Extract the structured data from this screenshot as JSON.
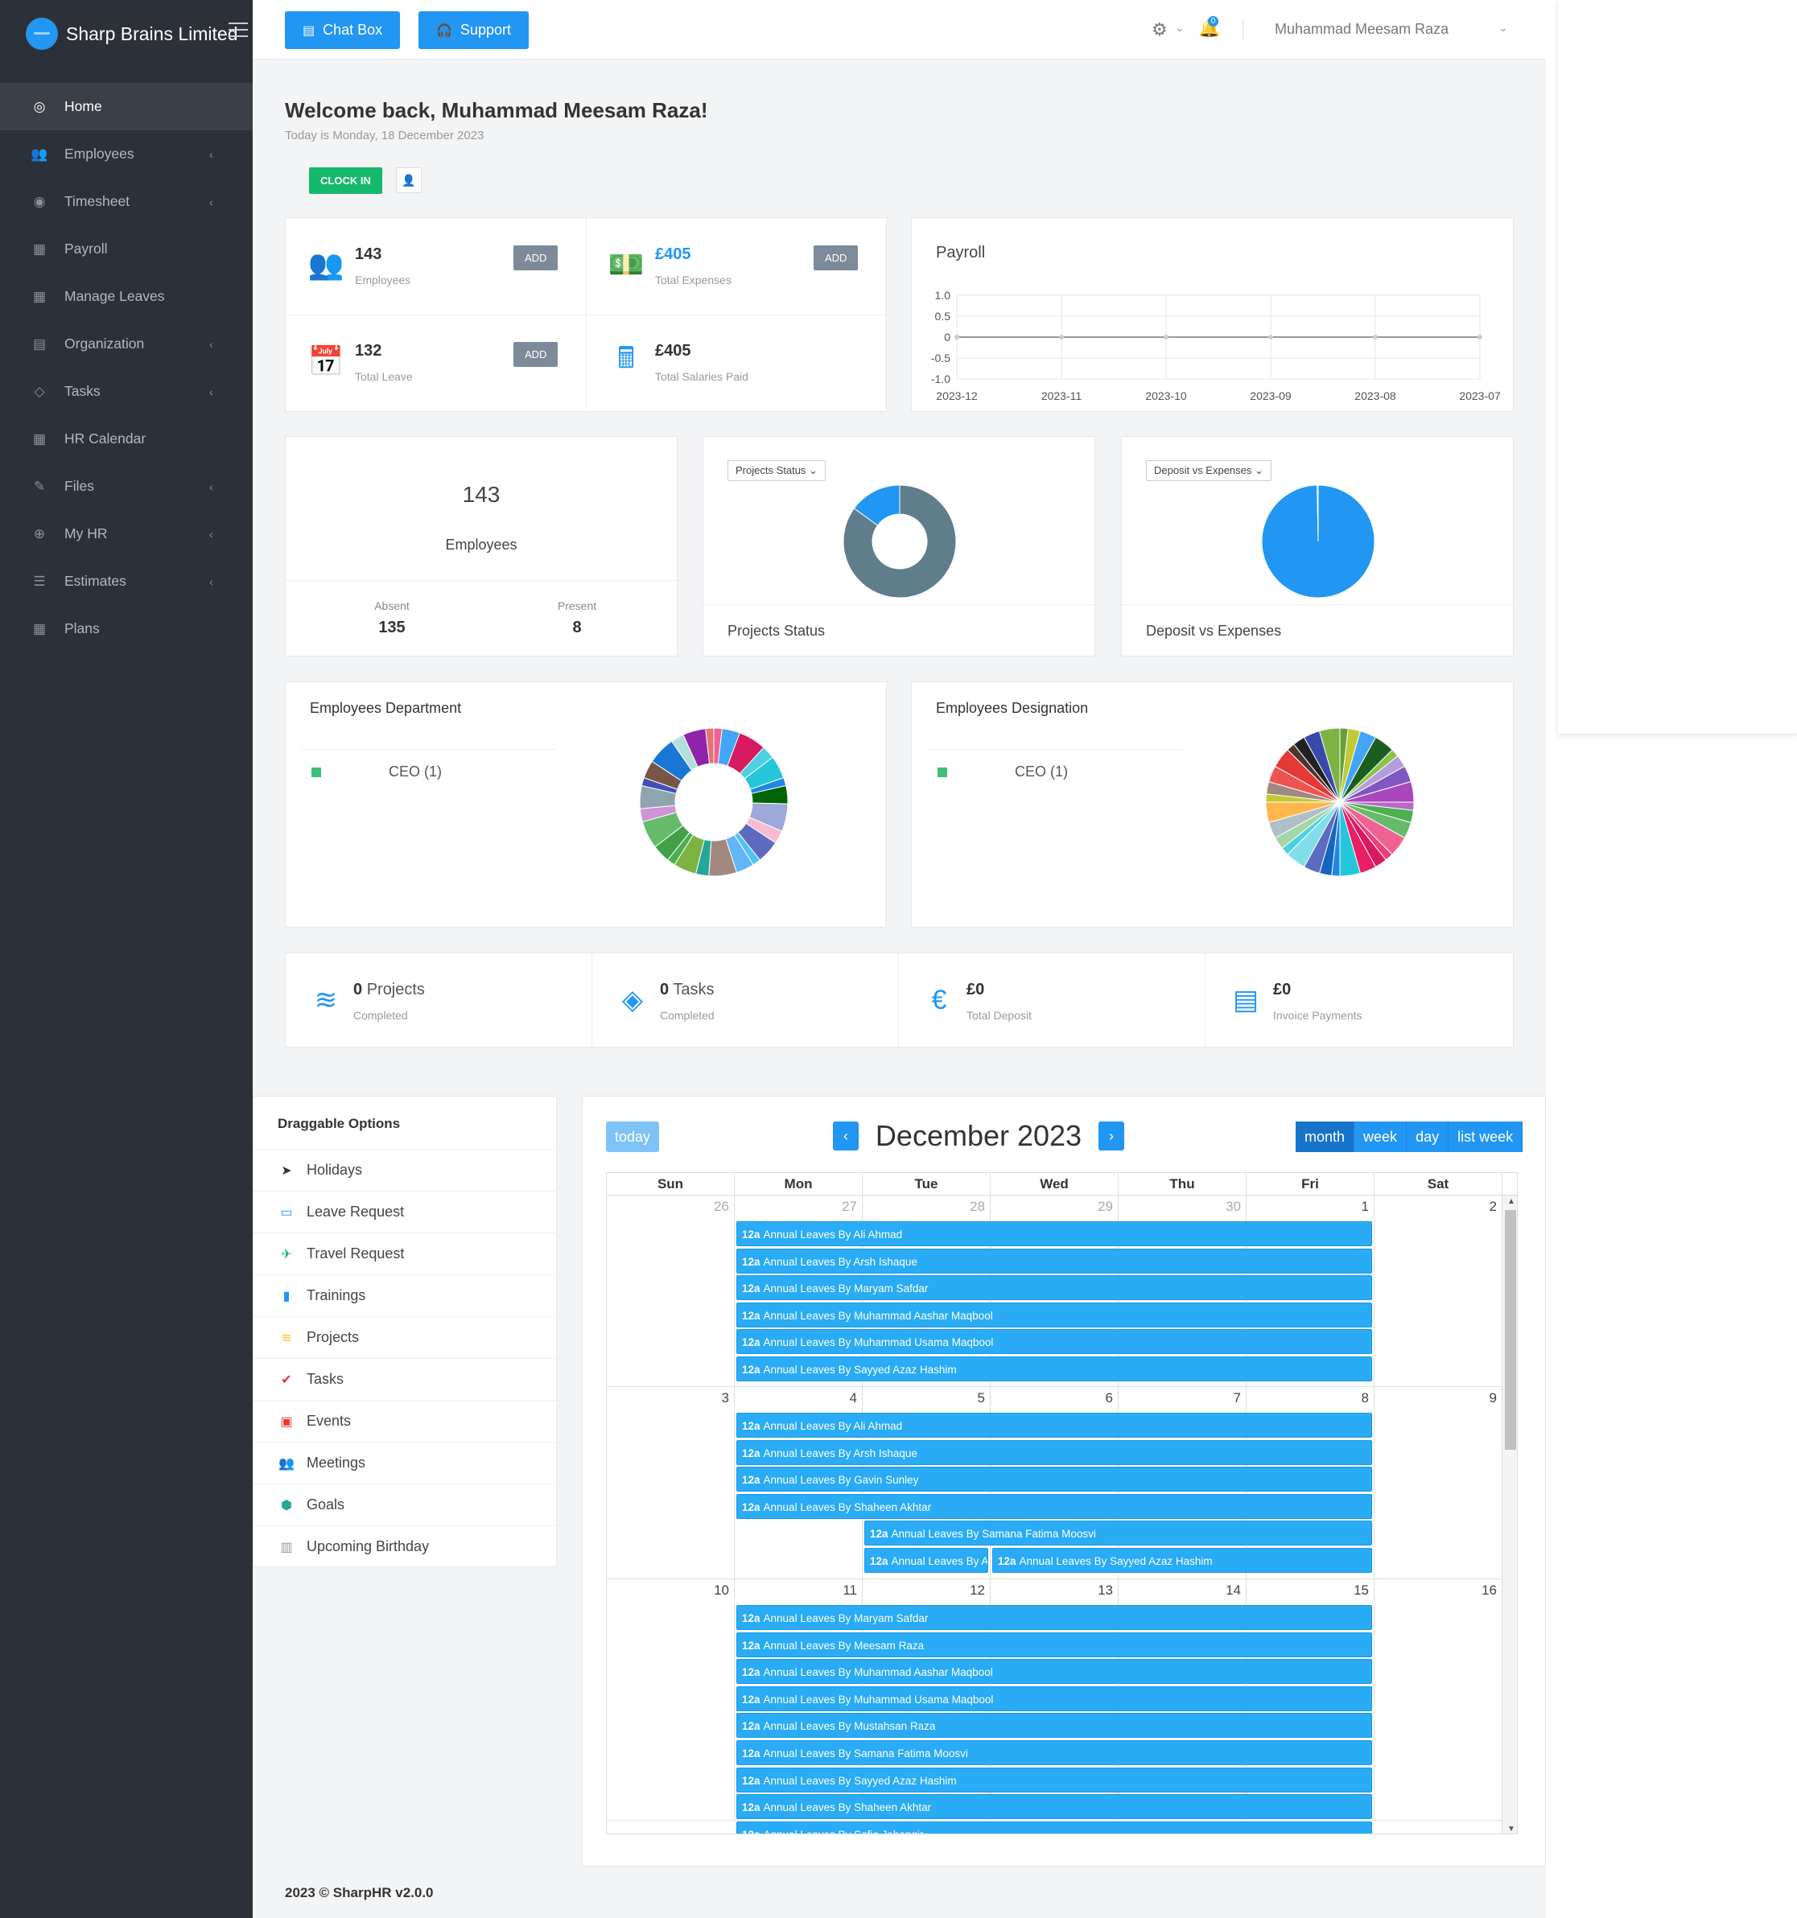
{
  "brand": {
    "name": "Sharp Brains Limited"
  },
  "nav": [
    {
      "label": "Home",
      "icon": "dashboard-icon",
      "glyph": "◎",
      "arrow": false,
      "active": true
    },
    {
      "label": "Employees",
      "icon": "users-icon",
      "glyph": "👥",
      "arrow": true
    },
    {
      "label": "Timesheet",
      "icon": "globe-icon",
      "glyph": "◉",
      "arrow": true
    },
    {
      "label": "Payroll",
      "icon": "calculator-icon",
      "glyph": "▦",
      "arrow": false
    },
    {
      "label": "Manage Leaves",
      "icon": "calendar-icon",
      "glyph": "▦",
      "arrow": false
    },
    {
      "label": "Organization",
      "icon": "building-icon",
      "glyph": "▤",
      "arrow": true
    },
    {
      "label": "Tasks",
      "icon": "diamond-icon",
      "glyph": "◇",
      "arrow": true
    },
    {
      "label": "HR Calendar",
      "icon": "calendar-grid-icon",
      "glyph": "▦",
      "arrow": false
    },
    {
      "label": "Files",
      "icon": "file-edit-icon",
      "glyph": "✎",
      "arrow": true
    },
    {
      "label": "My HR",
      "icon": "globe-icon",
      "glyph": "⊕",
      "arrow": true
    },
    {
      "label": "Estimates",
      "icon": "list-icon",
      "glyph": "☰",
      "arrow": true
    },
    {
      "label": "Plans",
      "icon": "calendar-icon",
      "glyph": "▦",
      "arrow": false
    }
  ],
  "topbar": {
    "chat_label": "Chat Box",
    "support_label": "Support",
    "notif_count": "0",
    "user_name": "Muhammad Meesam Raza"
  },
  "welcome": {
    "title": "Welcome back, Muhammad Meesam Raza!",
    "date": "Today is Monday, 18 December 2023",
    "clockin_label": "CLOCK IN"
  },
  "stats": [
    {
      "value": "143",
      "label": "Employees",
      "add": "ADD",
      "icon": "users-circle-icon",
      "glyph": "👥",
      "blue": false
    },
    {
      "value": "£405",
      "label": "Total Expenses",
      "add": "ADD",
      "icon": "money-icon",
      "glyph": "💵",
      "blue": true
    },
    {
      "value": "132",
      "label": "Total Leave",
      "add": "ADD",
      "icon": "calendar-icon",
      "glyph": "📅",
      "blue": false
    },
    {
      "value": "£405",
      "label": "Total Salaries Paid",
      "add": "",
      "icon": "calculator-icon",
      "glyph": "🖩",
      "blue": false
    }
  ],
  "payroll": {
    "title": "Payroll"
  },
  "employees_card": {
    "count": "143",
    "label": "Employees",
    "absent_label": "Absent",
    "absent": "135",
    "present_label": "Present",
    "present": "8"
  },
  "projects_status": {
    "select": "Projects Status",
    "title": "Projects Status"
  },
  "deposit_expenses": {
    "select": "Deposit vs Expenses",
    "title": "Deposit vs Expenses"
  },
  "department": {
    "title": "Employees Department",
    "legend": "CEO (1)"
  },
  "designation": {
    "title": "Employees Designation",
    "legend": "CEO (1)"
  },
  "bottom_stats": [
    {
      "value": "0",
      "suffix": "Projects",
      "label": "Completed",
      "icon": "layers-icon",
      "glyph": "≋"
    },
    {
      "value": "0",
      "suffix": "Tasks",
      "label": "Completed",
      "icon": "tasks-diamond-icon",
      "glyph": "◈"
    },
    {
      "value": "£0",
      "suffix": "",
      "label": "Total Deposit",
      "icon": "euro-icon",
      "glyph": "€"
    },
    {
      "value": "£0",
      "suffix": "",
      "label": "Invoice Payments",
      "icon": "invoice-icon",
      "glyph": "▤"
    }
  ],
  "draggable": {
    "title": "Draggable Options",
    "items": [
      {
        "label": "Holidays",
        "icon": "paper-plane-icon",
        "glyph": "➤",
        "color": "#333"
      },
      {
        "label": "Leave Request",
        "icon": "calendar-icon",
        "glyph": "▭",
        "color": "#2196f3"
      },
      {
        "label": "Travel Request",
        "icon": "airplane-icon",
        "glyph": "✈",
        "color": "#14b96b"
      },
      {
        "label": "Trainings",
        "icon": "id-badge-icon",
        "glyph": "▮",
        "color": "#2196f3"
      },
      {
        "label": "Projects",
        "icon": "layers-icon",
        "glyph": "≋",
        "color": "#f5c518"
      },
      {
        "label": "Tasks",
        "icon": "checklist-icon",
        "glyph": "✔",
        "color": "#e53935"
      },
      {
        "label": "Events",
        "icon": "calendar-event-icon",
        "glyph": "▣",
        "color": "#e53935"
      },
      {
        "label": "Meetings",
        "icon": "meeting-icon",
        "glyph": "👥",
        "color": "#5e35b1"
      },
      {
        "label": "Goals",
        "icon": "cube-icon",
        "glyph": "⬢",
        "color": "#26a69a"
      },
      {
        "label": "Upcoming Birthday",
        "icon": "gift-icon",
        "glyph": "▥",
        "color": "#999"
      }
    ]
  },
  "calendar": {
    "today_label": "today",
    "title": "December 2023",
    "views": [
      "month",
      "week",
      "day",
      "list week"
    ],
    "days": [
      "Sun",
      "Mon",
      "Tue",
      "Wed",
      "Thu",
      "Fri",
      "Sat"
    ],
    "weeks": [
      {
        "nums": [
          "26",
          "27",
          "28",
          "29",
          "30",
          "1",
          "2"
        ],
        "other": [
          true,
          true,
          true,
          true,
          true,
          false,
          false
        ],
        "events": [
          {
            "time": "12a",
            "title": "Annual Leaves By Ali Ahmad",
            "start": 1,
            "span": 5,
            "row": 0
          },
          {
            "time": "12a",
            "title": "Annual Leaves By Arsh Ishaque",
            "start": 1,
            "span": 5,
            "row": 1
          },
          {
            "time": "12a",
            "title": "Annual Leaves By Maryam Safdar",
            "start": 1,
            "span": 5,
            "row": 2
          },
          {
            "time": "12a",
            "title": "Annual Leaves By Muhammad Aashar Maqbool",
            "start": 1,
            "span": 5,
            "row": 3
          },
          {
            "time": "12a",
            "title": "Annual Leaves By Muhammad Usama Maqbool",
            "start": 1,
            "span": 5,
            "row": 4
          },
          {
            "time": "12a",
            "title": "Annual Leaves By Sayyed Azaz Hashim",
            "start": 1,
            "span": 5,
            "row": 5
          }
        ]
      },
      {
        "nums": [
          "3",
          "4",
          "5",
          "6",
          "7",
          "8",
          "9"
        ],
        "other": [
          false,
          false,
          false,
          false,
          false,
          false,
          false
        ],
        "events": [
          {
            "time": "12a",
            "title": "Annual Leaves By Ali Ahmad",
            "start": 1,
            "span": 5,
            "row": 0
          },
          {
            "time": "12a",
            "title": "Annual Leaves By Arsh Ishaque",
            "start": 1,
            "span": 5,
            "row": 1
          },
          {
            "time": "12a",
            "title": "Annual Leaves By Gavin Sunley",
            "start": 1,
            "span": 5,
            "row": 2
          },
          {
            "time": "12a",
            "title": "Annual Leaves By Shaheen Akhtar",
            "start": 1,
            "span": 5,
            "row": 3
          },
          {
            "time": "12a",
            "title": "Annual Leaves By Samana Fatima Moosvi",
            "start": 2,
            "span": 4,
            "row": 4
          },
          {
            "time": "12a",
            "title": "Annual Leaves By Amna Batool",
            "start": 2,
            "span": 1,
            "row": 5
          },
          {
            "time": "12a",
            "title": "Annual Leaves By Sayyed Azaz Hashim",
            "start": 3,
            "span": 3,
            "row": 5
          }
        ]
      },
      {
        "nums": [
          "10",
          "11",
          "12",
          "13",
          "14",
          "15",
          "16"
        ],
        "other": [
          false,
          false,
          false,
          false,
          false,
          false,
          false
        ],
        "events": [
          {
            "time": "12a",
            "title": "Annual Leaves By Maryam Safdar",
            "start": 1,
            "span": 5,
            "row": 0
          },
          {
            "time": "12a",
            "title": "Annual Leaves By Meesam Raza",
            "start": 1,
            "span": 5,
            "row": 1
          },
          {
            "time": "12a",
            "title": "Annual Leaves By Muhammad Aashar Maqbool",
            "start": 1,
            "span": 5,
            "row": 2
          },
          {
            "time": "12a",
            "title": "Annual Leaves By Muhammad Usama Maqbool",
            "start": 1,
            "span": 5,
            "row": 3
          },
          {
            "time": "12a",
            "title": "Annual Leaves By Mustahsan Raza",
            "start": 1,
            "span": 5,
            "row": 4
          },
          {
            "time": "12a",
            "title": "Annual Leaves By Samana Fatima Moosvi",
            "start": 1,
            "span": 5,
            "row": 5
          },
          {
            "time": "12a",
            "title": "Annual Leaves By Sayyed Azaz Hashim",
            "start": 1,
            "span": 5,
            "row": 6
          },
          {
            "time": "12a",
            "title": "Annual Leaves By Shaheen Akhtar",
            "start": 1,
            "span": 5,
            "row": 7
          },
          {
            "time": "12a",
            "title": "Annual Leaves By Sofia Jehangir",
            "start": 1,
            "span": 5,
            "row": 8
          }
        ]
      }
    ]
  },
  "footer": {
    "text": "2023 © SharpHR v2.0.0"
  },
  "chart_data": [
    {
      "type": "line",
      "title": "Payroll",
      "x": [
        "2023-12",
        "2023-11",
        "2023-10",
        "2023-09",
        "2023-08",
        "2023-07"
      ],
      "series": [
        {
          "values": [
            0,
            0,
            0,
            0,
            0,
            0
          ]
        }
      ],
      "yticks": [
        "1.0",
        "0.5",
        "0",
        "-0.5",
        "-1.0"
      ],
      "ylim": [
        -1,
        1
      ],
      "grid": true
    },
    {
      "type": "pie",
      "title": "Projects Status",
      "donut": true,
      "values": [
        85,
        15
      ],
      "colors": [
        "#607d8b",
        "#2196f3"
      ]
    },
    {
      "type": "pie",
      "title": "Deposit vs Expenses",
      "donut": false,
      "values": [
        99.7,
        0.3
      ],
      "colors": [
        "#2196f3",
        "#ffffff"
      ]
    },
    {
      "type": "pie",
      "title": "Employees Department",
      "donut": true,
      "legend": [
        "CEO (1)"
      ],
      "colors": [
        "#f06292",
        "#42a5f5",
        "#d81b60",
        "#4dd0e1",
        "#26c6da",
        "#1e88e5",
        "#006400",
        "#9fa8da",
        "#f8bbd0",
        "#5c6bc0",
        "#4fc3f7",
        "#64b5f6",
        "#a1887f",
        "#26a69a",
        "#7cb342",
        "#4caf50",
        "#43a047",
        "#66bb6a",
        "#ce93d8",
        "#90a4ae",
        "#3f51b5",
        "#795548",
        "#1976d2",
        "#b2dfdb",
        "#8e24aa",
        "#e57373"
      ]
    },
    {
      "type": "pie",
      "title": "Employees Designation",
      "donut": false,
      "legend": [
        "CEO (1)"
      ],
      "colors": [
        "#689f38",
        "#c0ca33",
        "#42a5f5",
        "#1b5e20",
        "#8bc34a",
        "#b39ddb",
        "#7e57c2",
        "#ab47bc",
        "#ba68c8",
        "#4caf50",
        "#66bb6a",
        "#f06292",
        "#ec407a",
        "#d81b60",
        "#e91e63",
        "#26c6da",
        "#1e88e5",
        "#1565c0",
        "#5c6bc0",
        "#80deea",
        "#4dd0e1",
        "#a5d6a7",
        "#b0bec5",
        "#ffb74d",
        "#c0ca33",
        "#a1887f",
        "#ef5350",
        "#e53935",
        "#4e342e",
        "#212121",
        "#3949ab",
        "#7cb342"
      ]
    }
  ]
}
